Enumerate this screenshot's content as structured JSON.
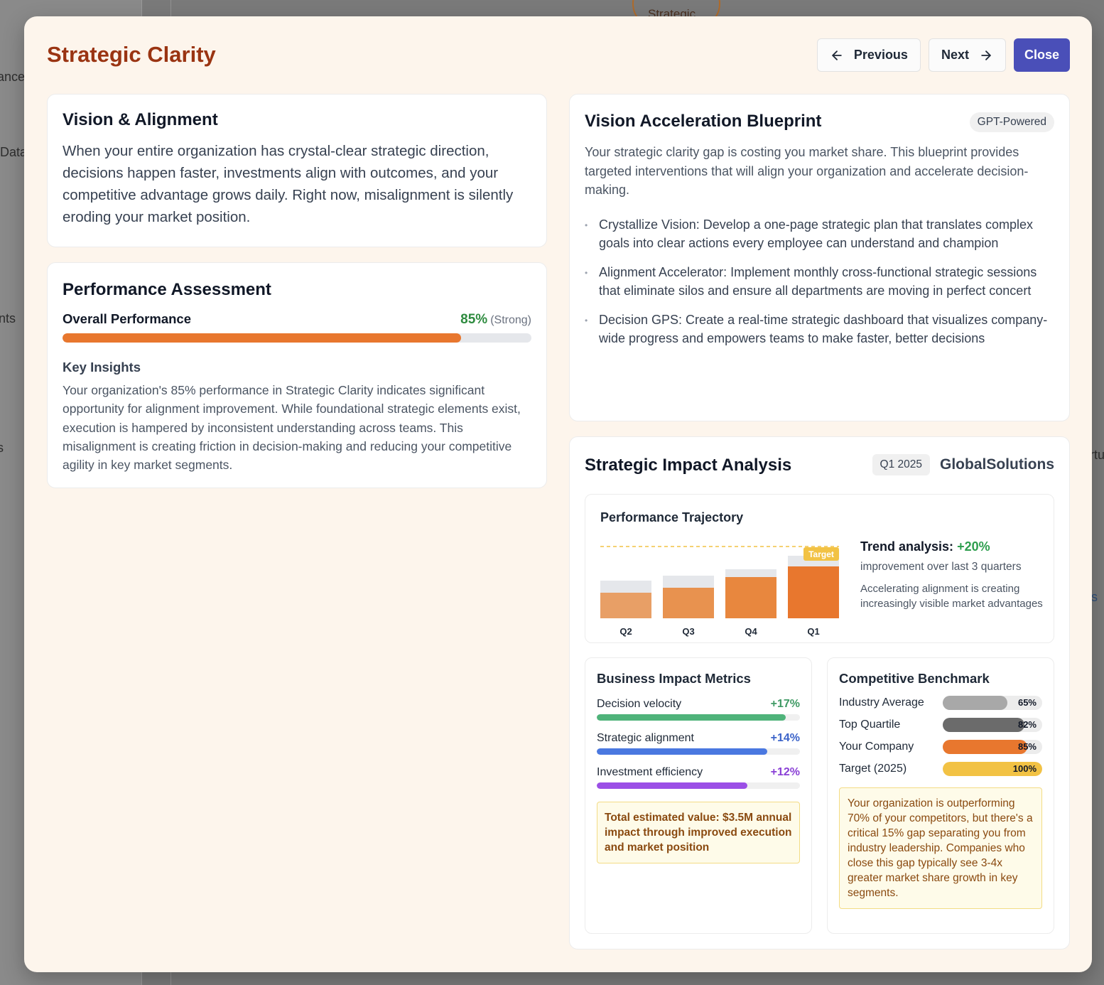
{
  "background": {
    "fragments": [
      "ance",
      "Data",
      "nts",
      "s",
      "rtu",
      "s"
    ],
    "circle_text": "Strategic"
  },
  "modal": {
    "title": "Strategic Clarity",
    "buttons": {
      "previous": "Previous",
      "next": "Next",
      "close": "Close"
    },
    "accent_color": "#4a4fb8",
    "title_color": "#9a3412"
  },
  "vision": {
    "title": "Vision & Alignment",
    "body": "When your entire organization has crystal-clear strategic direction, decisions happen faster, investments align with outcomes, and your competitive advantage grows daily. Right now, misalignment is silently eroding your market position."
  },
  "performance": {
    "title": "Performance Assessment",
    "label": "Overall Performance",
    "value": "85%",
    "rating": "(Strong)",
    "fill_fraction": 0.85,
    "insights_title": "Key Insights",
    "insights": "Your organization's 85% performance in Strategic Clarity indicates significant opportunity for alignment improvement. While foundational strategic elements exist, execution is hampered by inconsistent understanding across teams. This misalignment is creating friction in decision-making and reducing your competitive agility in key market segments."
  },
  "blueprint": {
    "title": "Vision Acceleration Blueprint",
    "tag": "GPT-Powered",
    "intro": "Your strategic clarity gap is costing you market share. This blueprint provides targeted interventions that will align your organization and accelerate decision-making.",
    "items": [
      "Crystallize Vision: Develop a one-page strategic plan that translates complex goals into clear actions every employee can understand and champion",
      "Alignment Accelerator: Implement monthly cross-functional strategic sessions that eliminate silos and ensure all departments are moving in perfect concert",
      "Decision GPS: Create a real-time strategic dashboard that visualizes company-wide progress and empowers teams to make faster, better decisions"
    ]
  },
  "impact": {
    "title": "Strategic Impact Analysis",
    "quarter": "Q1 2025",
    "company": "GlobalSolutions",
    "trajectory": {
      "title": "Performance Trajectory",
      "target_label": "Target",
      "trend_label": "Trend analysis:",
      "trend_value": "+20%",
      "trend_sub": "improvement over last 3 quarters",
      "trend_note": "Accelerating alignment is creating increasingly visible market advantages"
    },
    "metrics": {
      "title": "Business Impact Metrics",
      "items": [
        {
          "label": "Decision velocity",
          "pct": "+17%",
          "fill": 0.93,
          "color": "#4fb37a",
          "text_color": "#3f9a64"
        },
        {
          "label": "Strategic alignment",
          "pct": "+14%",
          "fill": 0.84,
          "color": "#4a78e0",
          "text_color": "#3b63c9"
        },
        {
          "label": "Investment efficiency",
          "pct": "+12%",
          "fill": 0.74,
          "color": "#9b4fe6",
          "text_color": "#8a40d6"
        }
      ],
      "value_note": "Total estimated value: $3.5M annual impact through improved execution and market position"
    },
    "benchmark": {
      "title": "Competitive Benchmark",
      "items": [
        {
          "label": "Industry Average",
          "value": "65%",
          "fill": 0.65,
          "color": "#a8a8a8"
        },
        {
          "label": "Top Quartile",
          "value": "82%",
          "fill": 0.82,
          "color": "#6b6b6b"
        },
        {
          "label": "Your Company",
          "value": "85%",
          "fill": 0.85,
          "color": "#e8772e"
        },
        {
          "label": "Target (2025)",
          "value": "100%",
          "fill": 1.0,
          "color": "#f2c244"
        }
      ],
      "note": "Your organization is outperforming 70% of your competitors, but there's a critical 15% gap separating you from industry leadership. Companies who close this gap typically see 3-4x greater market share growth in key segments."
    }
  },
  "chart_data": {
    "type": "bar",
    "categories": [
      "Q2",
      "Q3",
      "Q4",
      "Q1"
    ],
    "series": [
      {
        "values": [
          65,
          72,
          81,
          100
        ]
      },
      {
        "values": [
          48,
          55,
          70,
          85
        ]
      }
    ],
    "target_line": 100,
    "target_label": "Target",
    "ylim": [
      0,
      100
    ]
  }
}
